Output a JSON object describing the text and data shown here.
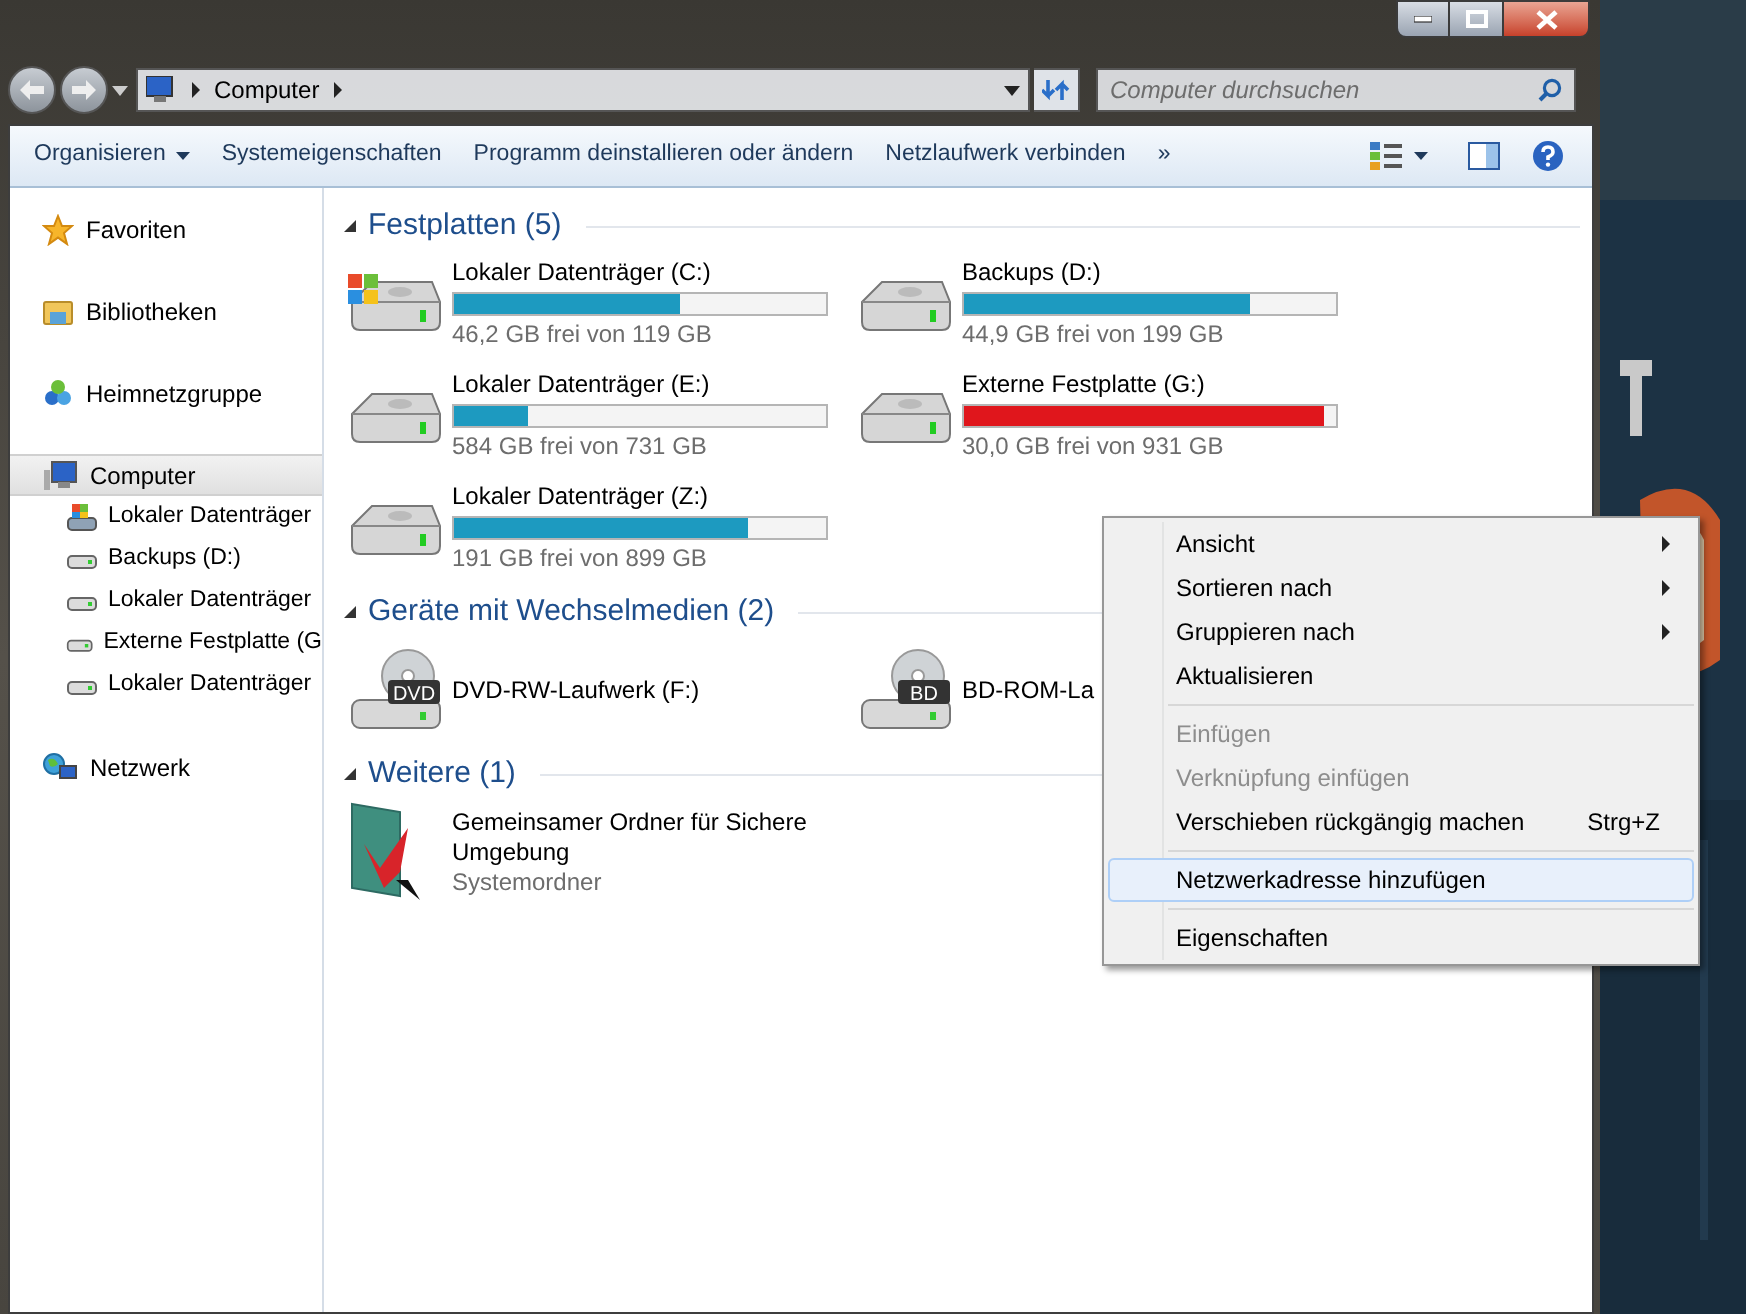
{
  "address_bar": {
    "crumbs": [
      "Computer"
    ]
  },
  "search": {
    "placeholder": "Computer durchsuchen"
  },
  "toolbar": {
    "items": [
      {
        "label": "Organisieren",
        "kind": "dropdown"
      },
      {
        "label": "Systemeigenschaften",
        "kind": "button"
      },
      {
        "label": "Programm deinstallieren oder ändern",
        "kind": "button"
      },
      {
        "label": "Netzlaufwerk verbinden",
        "kind": "button"
      },
      {
        "label": "»",
        "kind": "button"
      }
    ]
  },
  "navigation": [
    {
      "label": "Favoriten",
      "kind": "star",
      "selected": false
    },
    {
      "label": "Bibliotheken",
      "kind": "library",
      "selected": false
    },
    {
      "label": "Heimnetzgruppe",
      "kind": "homegroup",
      "selected": false
    },
    {
      "label": "Computer",
      "kind": "computer",
      "selected": true,
      "children": [
        {
          "label": "Lokaler Datenträger",
          "kind": "system-drive"
        },
        {
          "label": "Backups (D:)",
          "kind": "drive"
        },
        {
          "label": "Lokaler Datenträger",
          "kind": "drive"
        },
        {
          "label": "Externe Festplatte (G",
          "kind": "drive"
        },
        {
          "label": "Lokaler Datenträger",
          "kind": "drive"
        }
      ]
    },
    {
      "label": "Netzwerk",
      "kind": "network",
      "selected": false
    }
  ],
  "sections": [
    {
      "title": "Festplatten (5)",
      "expanded": true,
      "items": [
        {
          "name": "Lokaler Datenträger (C:)",
          "kind": "system-drive",
          "level": 0.61,
          "color": "#1d9ac0",
          "detail": "46,2 GB frei von 119 GB"
        },
        {
          "name": "Backups (D:)",
          "kind": "drive",
          "level": 0.77,
          "color": "#1d9ac0",
          "detail": "44,9 GB frei von 199 GB"
        },
        {
          "name": "Lokaler Datenträger (E:)",
          "kind": "drive",
          "level": 0.2,
          "color": "#1d9ac0",
          "detail": "584 GB frei von 731 GB"
        },
        {
          "name": "Externe Festplatte (G:)",
          "kind": "drive",
          "level": 0.97,
          "color": "#e0161c",
          "detail": "30,0 GB frei von 931 GB"
        },
        {
          "name": "Lokaler Datenträger (Z:)",
          "kind": "drive",
          "level": 0.79,
          "color": "#1d9ac0",
          "detail": "191 GB frei von 899 GB"
        }
      ]
    },
    {
      "title": "Geräte mit Wechselmedien (2)",
      "expanded": true,
      "items": [
        {
          "name": "DVD-RW-Laufwerk (F:)",
          "kind": "dvd",
          "badge": "DVD"
        },
        {
          "name": "BD-ROM-La",
          "kind": "dvd",
          "badge": "BD"
        }
      ]
    },
    {
      "title": "Weitere (1)",
      "expanded": true,
      "items": [
        {
          "name": "Gemeinsamer Ordner für Sichere Umgebung",
          "kind": "folder",
          "detail": "Systemordner"
        }
      ]
    }
  ],
  "context_menu": [
    {
      "kind": "item",
      "label": "Ansicht",
      "submenu": true,
      "disabled": false,
      "selected": false
    },
    {
      "kind": "item",
      "label": "Sortieren nach",
      "submenu": true,
      "disabled": false,
      "selected": false
    },
    {
      "kind": "item",
      "label": "Gruppieren nach",
      "submenu": true,
      "disabled": false,
      "selected": false
    },
    {
      "kind": "item",
      "label": "Aktualisieren",
      "submenu": false,
      "disabled": false,
      "selected": false
    },
    {
      "kind": "separator"
    },
    {
      "kind": "item",
      "label": "Einfügen",
      "submenu": false,
      "disabled": true,
      "selected": false
    },
    {
      "kind": "item",
      "label": "Verknüpfung einfügen",
      "submenu": false,
      "disabled": true,
      "selected": false
    },
    {
      "kind": "item",
      "label": "Verschieben rückgängig machen",
      "shortcut": "Strg+Z",
      "submenu": false,
      "disabled": false,
      "selected": false
    },
    {
      "kind": "separator"
    },
    {
      "kind": "item",
      "label": "Netzwerkadresse hinzufügen",
      "submenu": false,
      "disabled": false,
      "selected": true
    },
    {
      "kind": "separator"
    },
    {
      "kind": "item",
      "label": "Eigenschaften",
      "submenu": false,
      "disabled": false,
      "selected": false
    }
  ]
}
